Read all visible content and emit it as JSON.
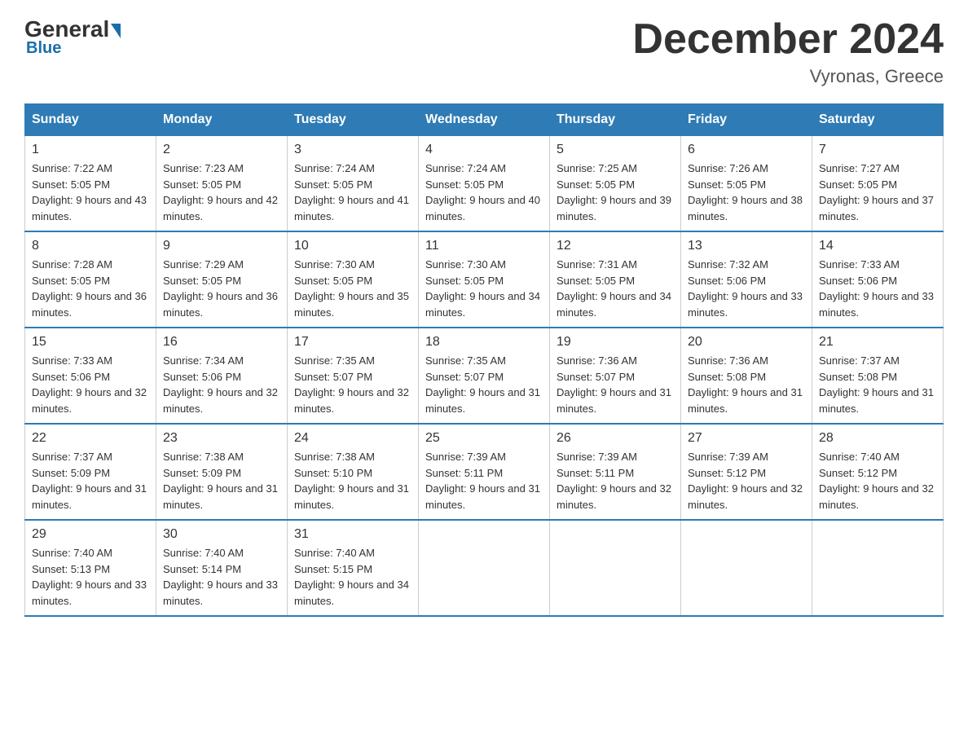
{
  "header": {
    "logo_general": "General",
    "logo_blue": "Blue",
    "month_title": "December 2024",
    "location": "Vyronas, Greece"
  },
  "days_of_week": [
    "Sunday",
    "Monday",
    "Tuesday",
    "Wednesday",
    "Thursday",
    "Friday",
    "Saturday"
  ],
  "weeks": [
    [
      {
        "day": "1",
        "sunrise": "Sunrise: 7:22 AM",
        "sunset": "Sunset: 5:05 PM",
        "daylight": "Daylight: 9 hours and 43 minutes."
      },
      {
        "day": "2",
        "sunrise": "Sunrise: 7:23 AM",
        "sunset": "Sunset: 5:05 PM",
        "daylight": "Daylight: 9 hours and 42 minutes."
      },
      {
        "day": "3",
        "sunrise": "Sunrise: 7:24 AM",
        "sunset": "Sunset: 5:05 PM",
        "daylight": "Daylight: 9 hours and 41 minutes."
      },
      {
        "day": "4",
        "sunrise": "Sunrise: 7:24 AM",
        "sunset": "Sunset: 5:05 PM",
        "daylight": "Daylight: 9 hours and 40 minutes."
      },
      {
        "day": "5",
        "sunrise": "Sunrise: 7:25 AM",
        "sunset": "Sunset: 5:05 PM",
        "daylight": "Daylight: 9 hours and 39 minutes."
      },
      {
        "day": "6",
        "sunrise": "Sunrise: 7:26 AM",
        "sunset": "Sunset: 5:05 PM",
        "daylight": "Daylight: 9 hours and 38 minutes."
      },
      {
        "day": "7",
        "sunrise": "Sunrise: 7:27 AM",
        "sunset": "Sunset: 5:05 PM",
        "daylight": "Daylight: 9 hours and 37 minutes."
      }
    ],
    [
      {
        "day": "8",
        "sunrise": "Sunrise: 7:28 AM",
        "sunset": "Sunset: 5:05 PM",
        "daylight": "Daylight: 9 hours and 36 minutes."
      },
      {
        "day": "9",
        "sunrise": "Sunrise: 7:29 AM",
        "sunset": "Sunset: 5:05 PM",
        "daylight": "Daylight: 9 hours and 36 minutes."
      },
      {
        "day": "10",
        "sunrise": "Sunrise: 7:30 AM",
        "sunset": "Sunset: 5:05 PM",
        "daylight": "Daylight: 9 hours and 35 minutes."
      },
      {
        "day": "11",
        "sunrise": "Sunrise: 7:30 AM",
        "sunset": "Sunset: 5:05 PM",
        "daylight": "Daylight: 9 hours and 34 minutes."
      },
      {
        "day": "12",
        "sunrise": "Sunrise: 7:31 AM",
        "sunset": "Sunset: 5:05 PM",
        "daylight": "Daylight: 9 hours and 34 minutes."
      },
      {
        "day": "13",
        "sunrise": "Sunrise: 7:32 AM",
        "sunset": "Sunset: 5:06 PM",
        "daylight": "Daylight: 9 hours and 33 minutes."
      },
      {
        "day": "14",
        "sunrise": "Sunrise: 7:33 AM",
        "sunset": "Sunset: 5:06 PM",
        "daylight": "Daylight: 9 hours and 33 minutes."
      }
    ],
    [
      {
        "day": "15",
        "sunrise": "Sunrise: 7:33 AM",
        "sunset": "Sunset: 5:06 PM",
        "daylight": "Daylight: 9 hours and 32 minutes."
      },
      {
        "day": "16",
        "sunrise": "Sunrise: 7:34 AM",
        "sunset": "Sunset: 5:06 PM",
        "daylight": "Daylight: 9 hours and 32 minutes."
      },
      {
        "day": "17",
        "sunrise": "Sunrise: 7:35 AM",
        "sunset": "Sunset: 5:07 PM",
        "daylight": "Daylight: 9 hours and 32 minutes."
      },
      {
        "day": "18",
        "sunrise": "Sunrise: 7:35 AM",
        "sunset": "Sunset: 5:07 PM",
        "daylight": "Daylight: 9 hours and 31 minutes."
      },
      {
        "day": "19",
        "sunrise": "Sunrise: 7:36 AM",
        "sunset": "Sunset: 5:07 PM",
        "daylight": "Daylight: 9 hours and 31 minutes."
      },
      {
        "day": "20",
        "sunrise": "Sunrise: 7:36 AM",
        "sunset": "Sunset: 5:08 PM",
        "daylight": "Daylight: 9 hours and 31 minutes."
      },
      {
        "day": "21",
        "sunrise": "Sunrise: 7:37 AM",
        "sunset": "Sunset: 5:08 PM",
        "daylight": "Daylight: 9 hours and 31 minutes."
      }
    ],
    [
      {
        "day": "22",
        "sunrise": "Sunrise: 7:37 AM",
        "sunset": "Sunset: 5:09 PM",
        "daylight": "Daylight: 9 hours and 31 minutes."
      },
      {
        "day": "23",
        "sunrise": "Sunrise: 7:38 AM",
        "sunset": "Sunset: 5:09 PM",
        "daylight": "Daylight: 9 hours and 31 minutes."
      },
      {
        "day": "24",
        "sunrise": "Sunrise: 7:38 AM",
        "sunset": "Sunset: 5:10 PM",
        "daylight": "Daylight: 9 hours and 31 minutes."
      },
      {
        "day": "25",
        "sunrise": "Sunrise: 7:39 AM",
        "sunset": "Sunset: 5:11 PM",
        "daylight": "Daylight: 9 hours and 31 minutes."
      },
      {
        "day": "26",
        "sunrise": "Sunrise: 7:39 AM",
        "sunset": "Sunset: 5:11 PM",
        "daylight": "Daylight: 9 hours and 32 minutes."
      },
      {
        "day": "27",
        "sunrise": "Sunrise: 7:39 AM",
        "sunset": "Sunset: 5:12 PM",
        "daylight": "Daylight: 9 hours and 32 minutes."
      },
      {
        "day": "28",
        "sunrise": "Sunrise: 7:40 AM",
        "sunset": "Sunset: 5:12 PM",
        "daylight": "Daylight: 9 hours and 32 minutes."
      }
    ],
    [
      {
        "day": "29",
        "sunrise": "Sunrise: 7:40 AM",
        "sunset": "Sunset: 5:13 PM",
        "daylight": "Daylight: 9 hours and 33 minutes."
      },
      {
        "day": "30",
        "sunrise": "Sunrise: 7:40 AM",
        "sunset": "Sunset: 5:14 PM",
        "daylight": "Daylight: 9 hours and 33 minutes."
      },
      {
        "day": "31",
        "sunrise": "Sunrise: 7:40 AM",
        "sunset": "Sunset: 5:15 PM",
        "daylight": "Daylight: 9 hours and 34 minutes."
      },
      null,
      null,
      null,
      null
    ]
  ]
}
